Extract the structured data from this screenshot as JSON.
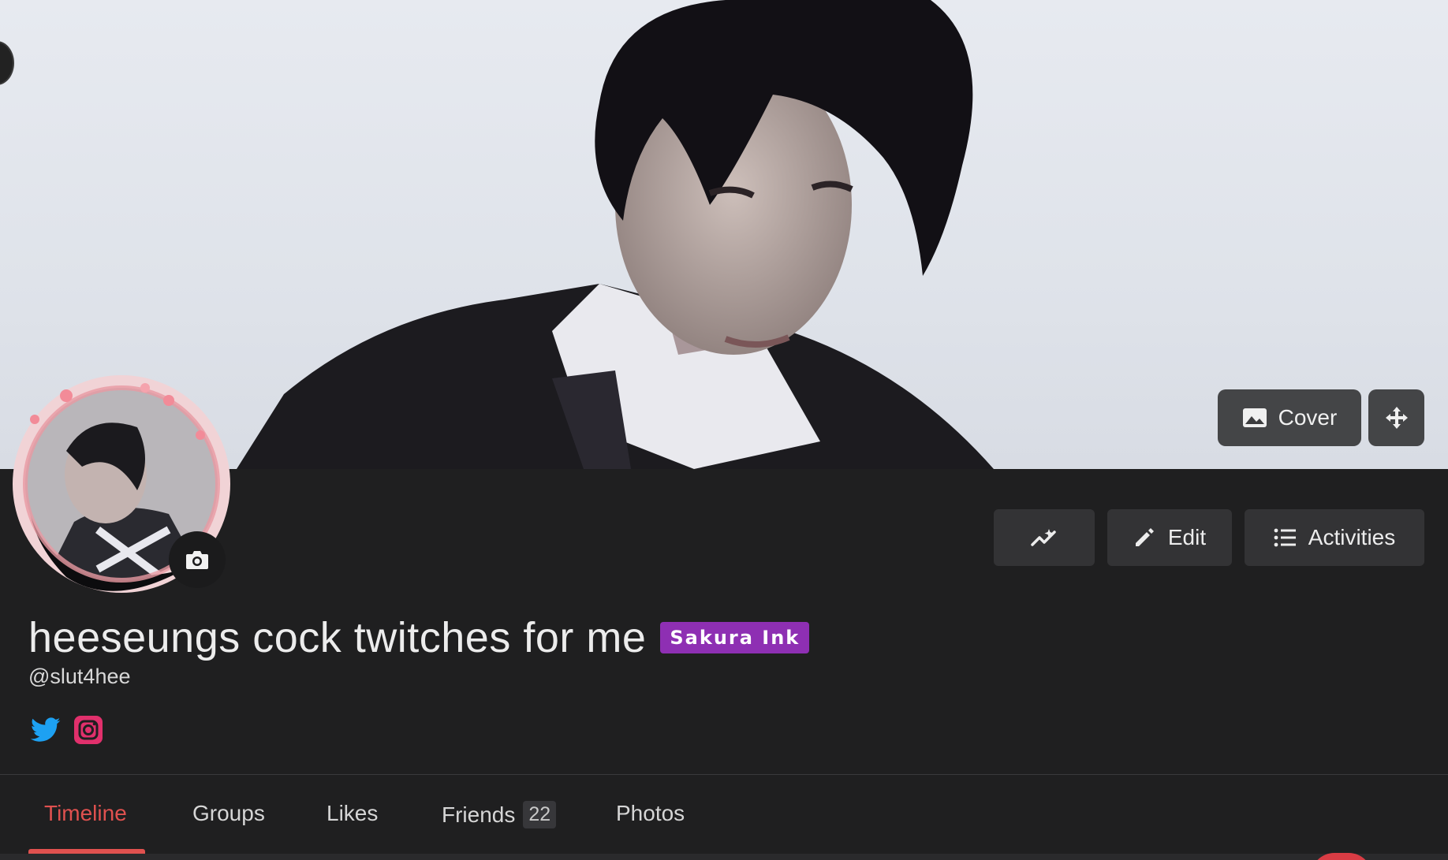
{
  "profile": {
    "display_name": "heeseungs cock twitches for me",
    "badge": "Sakura Ink",
    "handle": "@slut4hee"
  },
  "cover": {
    "change_label": "Cover"
  },
  "actions": {
    "edit_label": "Edit",
    "activities_label": "Activities"
  },
  "socials": [
    {
      "icon": "twitter-icon",
      "color": "#1da1f2"
    },
    {
      "icon": "instagram-icon",
      "color": "#e1306c"
    }
  ],
  "tabs": [
    {
      "label": "Timeline",
      "active": true
    },
    {
      "label": "Groups"
    },
    {
      "label": "Likes"
    },
    {
      "label": "Friends",
      "count": "22"
    },
    {
      "label": "Photos"
    }
  ],
  "colors": {
    "accent": "#e0514f",
    "badge": "#8e2fb3",
    "background": "#1f1f20"
  }
}
